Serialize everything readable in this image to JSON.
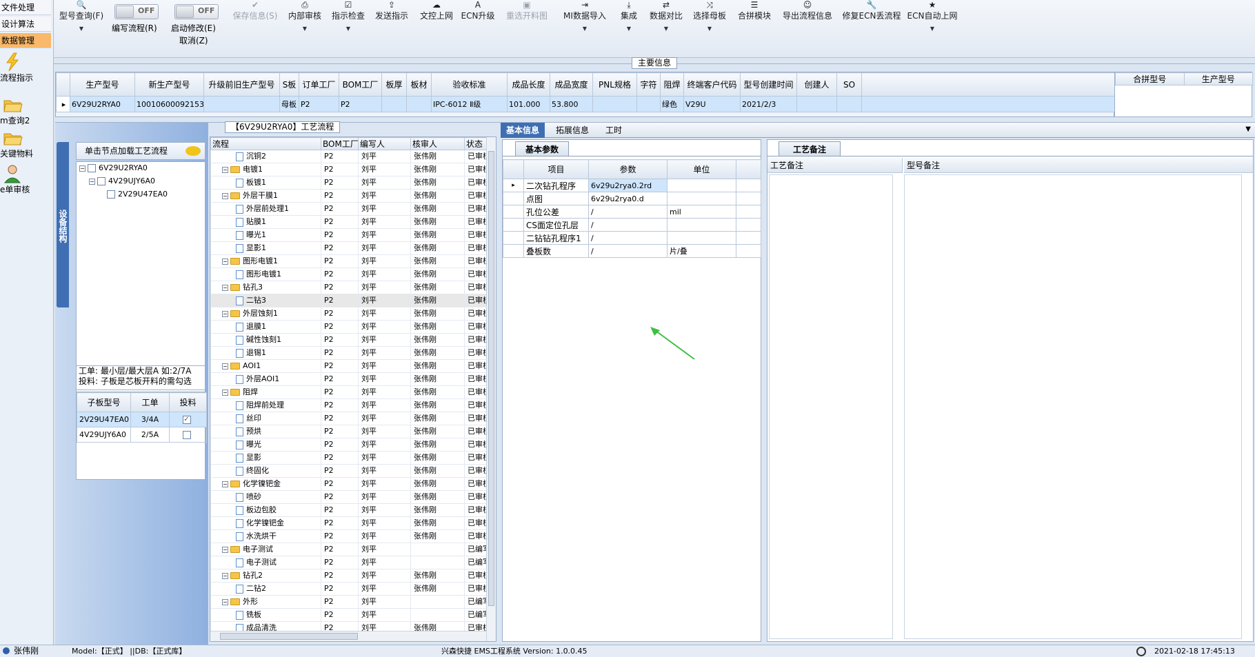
{
  "nav": {
    "tabs": [
      "文件处理",
      "设计算法",
      "数据管理"
    ],
    "items": [
      {
        "label": "流程指示",
        "icon": "lightning-icon"
      },
      {
        "label": "m查询2",
        "icon": "folder-open-icon"
      },
      {
        "label": "关键物料",
        "icon": "folder-open-icon"
      },
      {
        "label": "e单审核",
        "icon": "user-icon"
      }
    ]
  },
  "toolbar": {
    "model_query": "型号查询(F)",
    "edit_flow": "编写流程(R)",
    "edit_flow_toggle": "OFF",
    "start_modify": "启动修改(E)",
    "start_modify_toggle": "OFF",
    "cancel": "取消(Z)",
    "save_info": "保存信息(S)",
    "internal_review": "内部审核",
    "instruction_check": "指示检查",
    "send_instruction": "发送指示",
    "doc_control_upload": "文控上网",
    "ecn_upgrade": "ECN升级",
    "reselect_board_drawing": "重选开料图",
    "mi_data_import": "MI数据导入",
    "integrate": "集成",
    "data_compare": "数据对比",
    "select_mother_board": "选择母板",
    "merge_module": "合拼模块",
    "export_flow_info": "导出流程信息",
    "repair_ecn_lost_flow": "修复ECN丢流程",
    "ecn_auto_upload": "ECN自动上网"
  },
  "main_info": {
    "title": "主要信息",
    "columns": [
      "生产型号",
      "新生产型号",
      "升级前旧生产型号",
      "S板",
      "订单工厂",
      "BOM工厂",
      "板厚",
      "板材",
      "验收标准",
      "成品长度",
      "成品宽度",
      "PNL规格",
      "字符",
      "阻焊",
      "终端客户代码",
      "型号创建时间",
      "创建人",
      "SO"
    ],
    "row": [
      "6V29U2RYA0",
      "10010600092153",
      "",
      "母板",
      "P2",
      "P2",
      "",
      "",
      "IPC-6012 Ⅱ级",
      "101.000",
      "53.800",
      "",
      "",
      "绿色",
      "V29U",
      "2021/2/3",
      "",
      ""
    ],
    "side_columns": [
      "合拼型号",
      "生产型号"
    ]
  },
  "structure": {
    "vertical_tab": "设备结构",
    "hint": "单击节点加载工艺流程",
    "tree": [
      "6V29U2RYA0",
      "4V29UJY6A0",
      "2V29U47EA0"
    ],
    "note_line1": "工单: 最小层/最大层A 如:2/7A",
    "note_line2": "投料: 子板是芯板开料的需勾选",
    "sub_columns": [
      "子板型号",
      "工单",
      "投料"
    ],
    "sub_rows": [
      {
        "model": "2V29U47EA0",
        "order": "3/4A",
        "checked": true
      },
      {
        "model": "4V29UJY6A0",
        "order": "2/5A",
        "checked": false
      }
    ]
  },
  "process": {
    "title": "【6V29U2RYA0】工艺流程",
    "columns": [
      "流程",
      "BOM工厂",
      "编写人",
      "核审人",
      "状态"
    ],
    "rows": [
      {
        "name": "沉铜2",
        "level": 2,
        "type": "doc",
        "bom": "P2",
        "writer": "刘平",
        "reviewer": "张伟刚",
        "status": "已审核"
      },
      {
        "name": "电镀1",
        "level": 1,
        "type": "folder",
        "bom": "P2",
        "writer": "刘平",
        "reviewer": "张伟刚",
        "status": "已审核"
      },
      {
        "name": "板镀1",
        "level": 2,
        "type": "doc",
        "bom": "P2",
        "writer": "刘平",
        "reviewer": "张伟刚",
        "status": "已审核"
      },
      {
        "name": "外层干膜1",
        "level": 1,
        "type": "folder",
        "bom": "P2",
        "writer": "刘平",
        "reviewer": "张伟刚",
        "status": "已审核"
      },
      {
        "name": "外层前处理1",
        "level": 2,
        "type": "doc",
        "bom": "P2",
        "writer": "刘平",
        "reviewer": "张伟刚",
        "status": "已审核"
      },
      {
        "name": "贴膜1",
        "level": 2,
        "type": "doc",
        "bom": "P2",
        "writer": "刘平",
        "reviewer": "张伟刚",
        "status": "已审核"
      },
      {
        "name": "曝光1",
        "level": 2,
        "type": "doc",
        "bom": "P2",
        "writer": "刘平",
        "reviewer": "张伟刚",
        "status": "已审核"
      },
      {
        "name": "显影1",
        "level": 2,
        "type": "doc",
        "bom": "P2",
        "writer": "刘平",
        "reviewer": "张伟刚",
        "status": "已审核"
      },
      {
        "name": "图形电镀1",
        "level": 1,
        "type": "folder",
        "bom": "P2",
        "writer": "刘平",
        "reviewer": "张伟刚",
        "status": "已审核"
      },
      {
        "name": "图形电镀1",
        "level": 2,
        "type": "doc",
        "bom": "P2",
        "writer": "刘平",
        "reviewer": "张伟刚",
        "status": "已审核"
      },
      {
        "name": "钻孔3",
        "level": 1,
        "type": "folder",
        "bom": "P2",
        "writer": "刘平",
        "reviewer": "张伟刚",
        "status": "已审核"
      },
      {
        "name": "二钻3",
        "level": 2,
        "type": "doc",
        "bom": "P2",
        "writer": "刘平",
        "reviewer": "张伟刚",
        "status": "已审核",
        "selected": true
      },
      {
        "name": "外层蚀刻1",
        "level": 1,
        "type": "folder",
        "bom": "P2",
        "writer": "刘平",
        "reviewer": "张伟刚",
        "status": "已审核"
      },
      {
        "name": "退膜1",
        "level": 2,
        "type": "doc",
        "bom": "P2",
        "writer": "刘平",
        "reviewer": "张伟刚",
        "status": "已审核"
      },
      {
        "name": "碱性蚀刻1",
        "level": 2,
        "type": "doc",
        "bom": "P2",
        "writer": "刘平",
        "reviewer": "张伟刚",
        "status": "已审核"
      },
      {
        "name": "退锡1",
        "level": 2,
        "type": "doc",
        "bom": "P2",
        "writer": "刘平",
        "reviewer": "张伟刚",
        "status": "已审核"
      },
      {
        "name": "AOI1",
        "level": 1,
        "type": "folder",
        "bom": "P2",
        "writer": "刘平",
        "reviewer": "张伟刚",
        "status": "已审核"
      },
      {
        "name": "外层AOI1",
        "level": 2,
        "type": "doc",
        "bom": "P2",
        "writer": "刘平",
        "reviewer": "张伟刚",
        "status": "已审核"
      },
      {
        "name": "阻焊",
        "level": 1,
        "type": "folder",
        "bom": "P2",
        "writer": "刘平",
        "reviewer": "张伟刚",
        "status": "已审核"
      },
      {
        "name": "阻焊前处理",
        "level": 2,
        "type": "doc",
        "bom": "P2",
        "writer": "刘平",
        "reviewer": "张伟刚",
        "status": "已审核"
      },
      {
        "name": "丝印",
        "level": 2,
        "type": "doc",
        "bom": "P2",
        "writer": "刘平",
        "reviewer": "张伟刚",
        "status": "已审核"
      },
      {
        "name": "预烘",
        "level": 2,
        "type": "doc",
        "bom": "P2",
        "writer": "刘平",
        "reviewer": "张伟刚",
        "status": "已审核"
      },
      {
        "name": "曝光",
        "level": 2,
        "type": "doc",
        "bom": "P2",
        "writer": "刘平",
        "reviewer": "张伟刚",
        "status": "已审核"
      },
      {
        "name": "显影",
        "level": 2,
        "type": "doc",
        "bom": "P2",
        "writer": "刘平",
        "reviewer": "张伟刚",
        "status": "已审核"
      },
      {
        "name": "终固化",
        "level": 2,
        "type": "doc",
        "bom": "P2",
        "writer": "刘平",
        "reviewer": "张伟刚",
        "status": "已审核"
      },
      {
        "name": "化学镍钯金",
        "level": 1,
        "type": "folder",
        "bom": "P2",
        "writer": "刘平",
        "reviewer": "张伟刚",
        "status": "已审核"
      },
      {
        "name": "喷砂",
        "level": 2,
        "type": "doc",
        "bom": "P2",
        "writer": "刘平",
        "reviewer": "张伟刚",
        "status": "已审核"
      },
      {
        "name": "板边包胶",
        "level": 2,
        "type": "doc",
        "bom": "P2",
        "writer": "刘平",
        "reviewer": "张伟刚",
        "status": "已审核"
      },
      {
        "name": "化学镍钯金",
        "level": 2,
        "type": "doc",
        "bom": "P2",
        "writer": "刘平",
        "reviewer": "张伟刚",
        "status": "已审核"
      },
      {
        "name": "水洗烘干",
        "level": 2,
        "type": "doc",
        "bom": "P2",
        "writer": "刘平",
        "reviewer": "张伟刚",
        "status": "已审核"
      },
      {
        "name": "电子测试",
        "level": 1,
        "type": "folder",
        "bom": "P2",
        "writer": "刘平",
        "reviewer": "",
        "status": "已编写"
      },
      {
        "name": "电子测试",
        "level": 2,
        "type": "doc",
        "bom": "P2",
        "writer": "刘平",
        "reviewer": "",
        "status": "已编写"
      },
      {
        "name": "钻孔2",
        "level": 1,
        "type": "folder",
        "bom": "P2",
        "writer": "刘平",
        "reviewer": "张伟刚",
        "status": "已审核"
      },
      {
        "name": "二钻2",
        "level": 2,
        "type": "doc",
        "bom": "P2",
        "writer": "刘平",
        "reviewer": "张伟刚",
        "status": "已审核"
      },
      {
        "name": "外形",
        "level": 1,
        "type": "folder",
        "bom": "P2",
        "writer": "刘平",
        "reviewer": "",
        "status": "已编写"
      },
      {
        "name": "铣板",
        "level": 2,
        "type": "doc",
        "bom": "P2",
        "writer": "刘平",
        "reviewer": "",
        "status": "已编写"
      },
      {
        "name": "成品清洗",
        "level": 2,
        "type": "doc",
        "bom": "P2",
        "writer": "刘平",
        "reviewer": "张伟刚",
        "status": "已审核"
      }
    ]
  },
  "detail": {
    "tabs": [
      "基本信息",
      "拓展信息",
      "工时"
    ],
    "basic_params_title": "基本参数",
    "param_columns": [
      "项目",
      "参数",
      "单位"
    ],
    "params": [
      {
        "item": "二次钻孔程序",
        "value": "6v29u2rya0.2rd",
        "unit": ""
      },
      {
        "item": "点图",
        "value": "6v29u2rya0.d",
        "unit": ""
      },
      {
        "item": "孔位公差",
        "value": "/",
        "unit": "mil"
      },
      {
        "item": "CS面定位孔层",
        "value": "/",
        "unit": ""
      },
      {
        "item": "二钻钻孔程序1",
        "value": "/",
        "unit": ""
      },
      {
        "item": "叠板数",
        "value": "/",
        "unit": "片/叠"
      }
    ],
    "notes_title": "工艺备注",
    "notes_columns": [
      "工艺备注",
      "型号备注"
    ]
  },
  "status": {
    "user": "张伟刚",
    "model": "Model:【正式】 ||DB:【正式库】",
    "system": "兴森快捷 EMS工程系统 Version: 1.0.0.45",
    "datetime": "2021-02-18 17:45:13"
  },
  "colors": {
    "accent": "#3f6fb2",
    "selected_row": "#cfe5fb",
    "active_nav": "#f9b86a"
  }
}
